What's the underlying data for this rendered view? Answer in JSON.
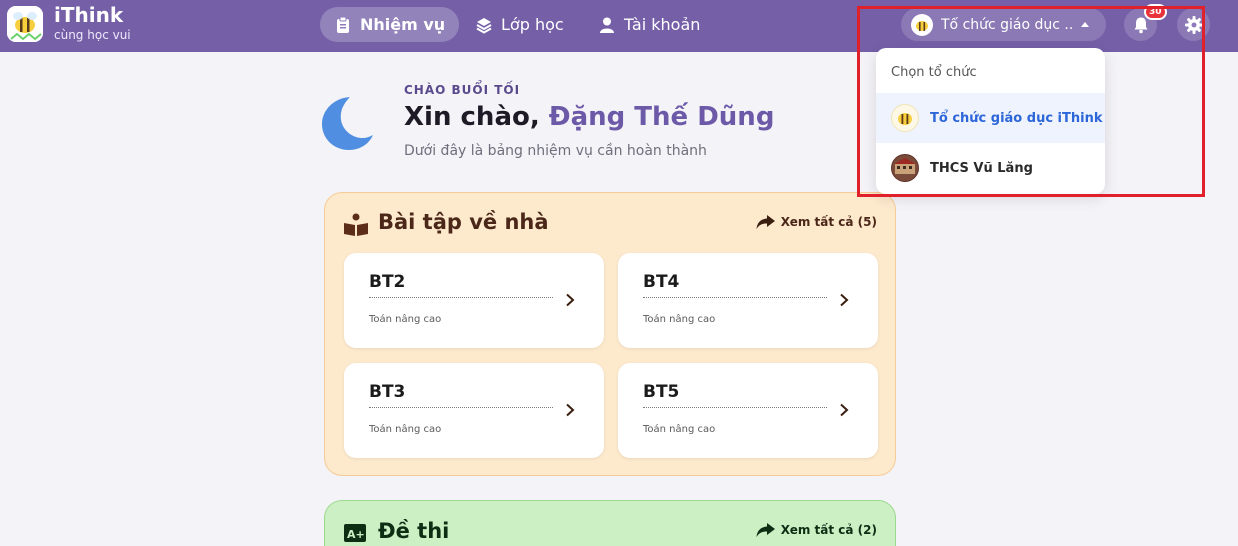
{
  "app": {
    "name": "iThink",
    "tagline": "cùng học vui"
  },
  "nav": [
    {
      "label": "Nhiệm vụ",
      "icon": "clipboard-icon",
      "active": true
    },
    {
      "label": "Lớp học",
      "icon": "layers-icon",
      "active": false
    },
    {
      "label": "Tài khoản",
      "icon": "user-icon",
      "active": false
    }
  ],
  "org": {
    "current": "Tổ chức giáo dục ...",
    "dropdown_title": "Chọn tổ chức",
    "options": [
      {
        "label": "Tổ chức giáo dục iThink",
        "selected": true
      },
      {
        "label": "THCS Vũ Lăng",
        "selected": false
      }
    ]
  },
  "notifications": {
    "count": "30"
  },
  "greeting": {
    "small": "CHÀO BUỔI TỐI",
    "hello": "Xin chào, ",
    "name": "Đặng Thế Dũng",
    "sub": "Dưới đây là bảng nhiệm vụ cần hoàn thành"
  },
  "homework": {
    "title": "Bài tập về nhà",
    "see_all": "Xem tất cả (5)",
    "cards": [
      {
        "title": "BT2",
        "subject": "Toán nâng cao"
      },
      {
        "title": "BT4",
        "subject": "Toán nâng cao"
      },
      {
        "title": "BT3",
        "subject": "Toán nâng cao"
      },
      {
        "title": "BT5",
        "subject": "Toán nâng cao"
      }
    ]
  },
  "exams": {
    "title": "Đề thi",
    "see_all": "Xem tất cả (2)"
  },
  "colors": {
    "header": "#7560a8",
    "accent_name": "#6c5aa8",
    "homework_bg": "#fde9cc",
    "exam_bg": "#ccf0c4",
    "highlight": "#e0202a"
  }
}
